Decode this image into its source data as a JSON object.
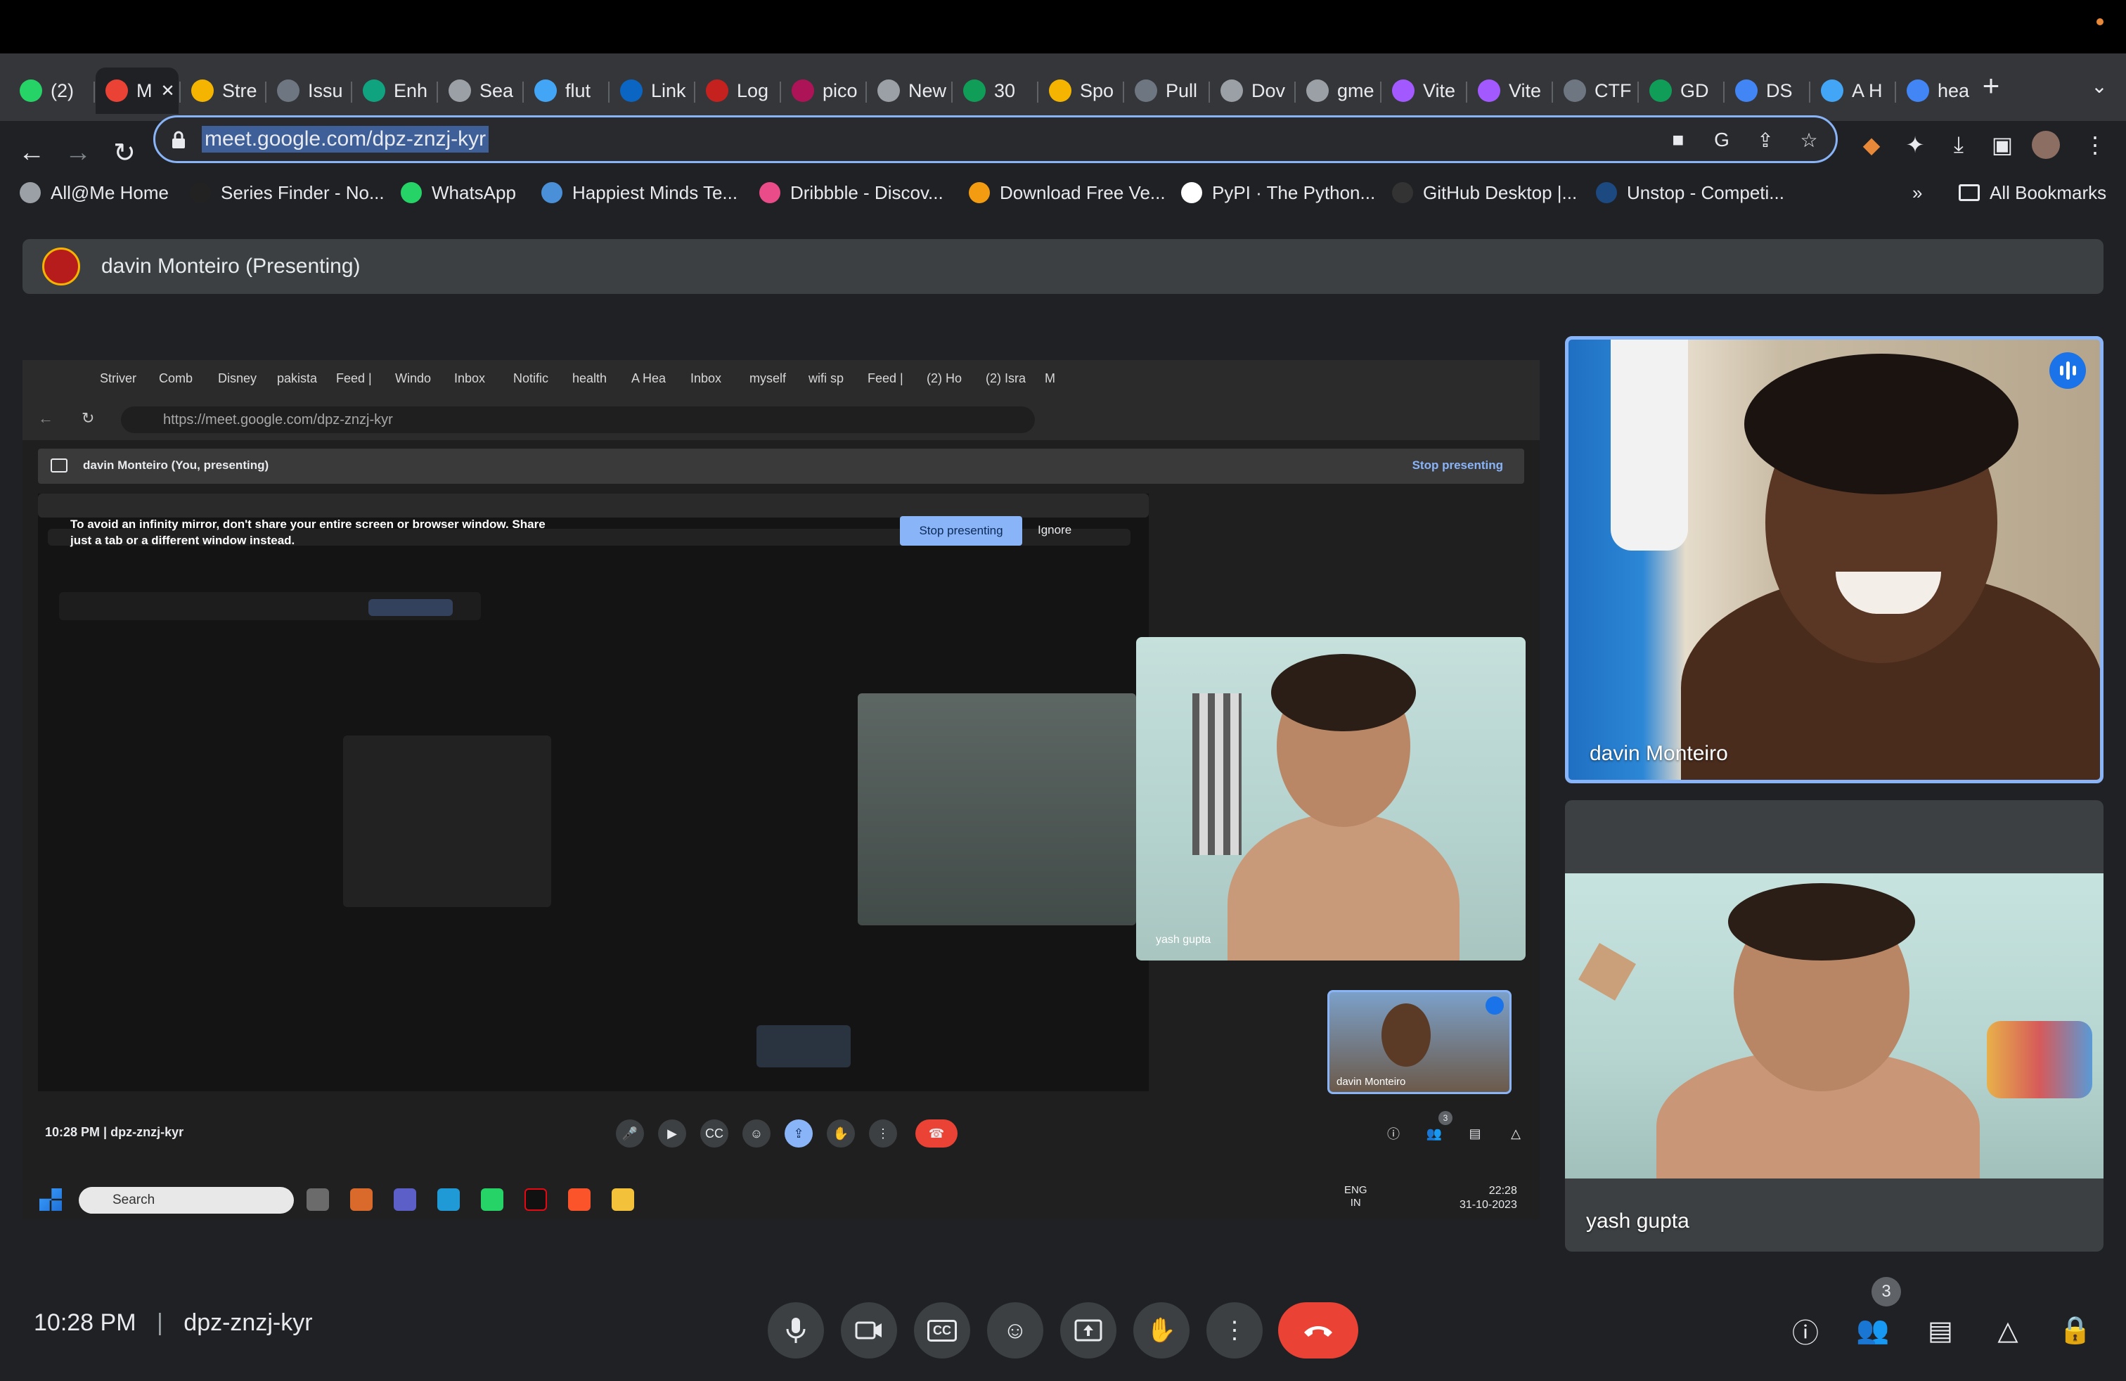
{
  "browser": {
    "tabs": [
      {
        "label": "(2)",
        "color": "#25d366",
        "icon": "whatsapp-icon"
      },
      {
        "label": "M",
        "color": "#ea4335",
        "icon": "meet-icon",
        "active": true
      },
      {
        "label": "Stre",
        "color": "#f4b400",
        "icon": "slides-icon"
      },
      {
        "label": "Issu",
        "color": "#6e7681",
        "icon": "github-icon"
      },
      {
        "label": "Enh",
        "color": "#10a37f",
        "icon": "chatgpt-icon"
      },
      {
        "label": "Sea",
        "color": "#9aa0a6",
        "icon": "search-icon"
      },
      {
        "label": "flut",
        "color": "#42a5f5",
        "icon": "flutter-icon"
      },
      {
        "label": "Link",
        "color": "#0a66c2",
        "icon": "linkedin-icon"
      },
      {
        "label": "Log",
        "color": "#c5221f",
        "icon": "target-icon"
      },
      {
        "label": "pico",
        "color": "#ad1457",
        "icon": "pico-icon"
      },
      {
        "label": "New",
        "color": "#9aa0a6",
        "icon": "chrome-icon"
      },
      {
        "label": "30",
        "color": "#0f9d58",
        "icon": "drive-icon"
      },
      {
        "label": "Spo",
        "color": "#f4b400",
        "icon": "spo-icon"
      },
      {
        "label": "Pull",
        "color": "#6e7681",
        "icon": "github-icon"
      },
      {
        "label": "Dov",
        "color": "#9aa0a6",
        "icon": "download-icon"
      },
      {
        "label": "gme",
        "color": "#9aa0a6",
        "icon": "gmeet-icon"
      },
      {
        "label": "Vite",
        "color": "#a259ff",
        "icon": "vite-icon"
      },
      {
        "label": "Vite",
        "color": "#a259ff",
        "icon": "vite-icon"
      },
      {
        "label": "CTF",
        "color": "#6e7681",
        "icon": "github-icon"
      },
      {
        "label": "GD",
        "color": "#0f9d58",
        "icon": "drive-icon"
      },
      {
        "label": "DS",
        "color": "#4285f4",
        "icon": "docs-icon"
      },
      {
        "label": "A H",
        "color": "#42a5f5",
        "icon": "flutter-icon"
      },
      {
        "label": "hea",
        "color": "#4285f4",
        "icon": "google-icon"
      }
    ],
    "new_tab_label": "+",
    "url": "meet.google.com/dpz-znzj-kyr",
    "bookmarks": [
      {
        "label": "All@Me Home",
        "color": "#9aa0a6",
        "icon": "globe-icon"
      },
      {
        "label": "Series Finder - No...",
        "color": "#222",
        "icon": "notion-icon"
      },
      {
        "label": "WhatsApp",
        "color": "#25d366",
        "icon": "whatsapp-icon"
      },
      {
        "label": "Happiest Minds Te...",
        "color": "#4a90d9",
        "icon": "happiest-minds-icon"
      },
      {
        "label": "Dribbble - Discov...",
        "color": "#ea4c89",
        "icon": "dribbble-icon"
      },
      {
        "label": "Download Free Ve...",
        "color": "#f39c12",
        "icon": "freepik-icon"
      },
      {
        "label": "PyPI · The Python...",
        "color": "#ffffff",
        "icon": "pypi-icon"
      },
      {
        "label": "GitHub Desktop |...",
        "color": "#333",
        "icon": "github-icon"
      },
      {
        "label": "Unstop - Competi...",
        "color": "#1c4980",
        "icon": "unstop-icon"
      }
    ],
    "bookmarks_overflow": "»",
    "all_bookmarks": "All Bookmarks"
  },
  "meet": {
    "presenter_bar": "davin Monteiro (Presenting)",
    "shared_screen": {
      "tabs": [
        "Striver",
        "Comb",
        "Disney",
        "pakista",
        "Feed |",
        "Windo",
        "Inbox",
        "Notific",
        "health",
        "A Hea",
        "Inbox",
        "myself",
        "wifi sp",
        "Feed |",
        "(2) Ho",
        "(2) Isra",
        "M"
      ],
      "url": "https://meet.google.com/dpz-znzj-kyr",
      "presenting_bar": "davin Monteiro (You, presenting)",
      "stop_presenting": "Stop presenting",
      "warning": "To avoid an infinity mirror, don't share your entire screen or browser window. Share just a tab or a different window instead.",
      "stop_button": "Stop presenting",
      "ignore_button": "Ignore",
      "tile_name": "yash gupta",
      "self_name": "davin Monteiro",
      "time": "10:28 PM",
      "code": "dpz-znzj-kyr",
      "participants_badge": "3",
      "taskbar": {
        "search": "Search",
        "lang": "ENG",
        "region": "IN",
        "clock_time": "22:28",
        "clock_date": "31-10-2023"
      }
    },
    "tiles": [
      {
        "name": "davin Monteiro",
        "speaking": true
      },
      {
        "name": "yash gupta",
        "speaking": false
      }
    ],
    "bottom": {
      "time": "10:28 PM",
      "separator": "|",
      "code": "dpz-znzj-kyr",
      "participants_count": "3"
    }
  }
}
